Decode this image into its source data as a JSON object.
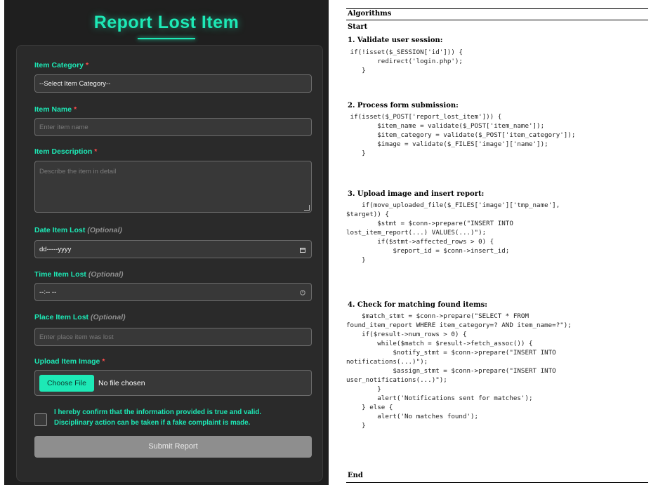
{
  "form": {
    "title": "Report Lost Item",
    "fields": {
      "category": {
        "label": "Item Category",
        "required": "*",
        "value": "--Select Item Category--"
      },
      "name": {
        "label": "Item Name",
        "required": "*",
        "placeholder": "Enter item name"
      },
      "description": {
        "label": "Item Description",
        "required": "*",
        "placeholder": "Describe the item in detail"
      },
      "date": {
        "label": "Date Item Lost",
        "optional": "(Optional)",
        "value": "dd-----yyyy"
      },
      "time": {
        "label": "Time Item Lost",
        "optional": "(Optional)",
        "value": "--:-- --"
      },
      "place": {
        "label": "Place Item Lost",
        "optional": "(Optional)",
        "placeholder": "Enter place item was lost"
      },
      "image": {
        "label": "Upload Item Image",
        "required": "*",
        "button": "Choose File",
        "status": "No file chosen"
      }
    },
    "confirm_line1": "I hereby confirm that the information provided is true and valid.",
    "confirm_line2": "Disciplinary action can be taken if a fake complaint is made.",
    "submit": "Submit Report",
    "accent": "#1de9b6"
  },
  "algorithm": {
    "header": "Algorithms",
    "start": "Start",
    "end": "End",
    "steps": [
      {
        "title": "1. Validate user session:",
        "code": [
          " if(!isset($_SESSION['id'])) {",
          "        redirect('login.php');",
          "    }"
        ]
      },
      {
        "title": "2. Process form submission:",
        "code": [
          " if(isset($_POST['report_lost_item'])) {",
          "        $item_name = validate($_POST['item_name']);",
          "        $item_category = validate($_POST['item_category']);",
          "        $image = validate($_FILES['image']['name']);",
          "    }"
        ]
      },
      {
        "title": "3. Upload image and insert report:",
        "code": [
          "    if(move_uploaded_file($_FILES['image']['tmp_name'],",
          "$target)) {",
          "        $stmt = $conn->prepare(\"INSERT INTO",
          "lost_item_report(...) VALUES(...)\");",
          "        if($stmt->affected_rows > 0) {",
          "            $report_id = $conn->insert_id;",
          "    }"
        ]
      },
      {
        "title": "4. Check for matching found items:",
        "code": [
          "    $match_stmt = $conn->prepare(\"SELECT * FROM",
          "found_item_report WHERE item_category=? AND item_name=?\");",
          "    if($result->num_rows > 0) {",
          "        while($match = $result->fetch_assoc()) {",
          "            $notify_stmt = $conn->prepare(\"INSERT INTO",
          "notifications(...)\");",
          "            $assign_stmt = $conn->prepare(\"INSERT INTO",
          "user_notifications(...)\");",
          "        }",
          "        alert('Notifications sent for matches');",
          "    } else {",
          "        alert('No matches found');",
          "    }"
        ]
      }
    ]
  }
}
